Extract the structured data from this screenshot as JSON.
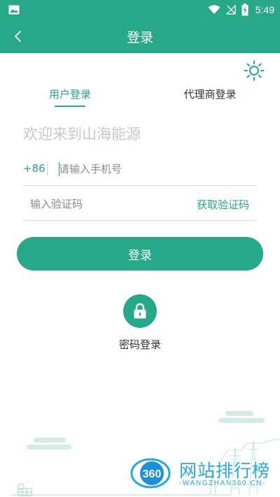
{
  "status_bar": {
    "time": "5:49",
    "icons": [
      "image-icon",
      "wifi-icon",
      "signal-off-icon",
      "battery-charging-icon"
    ]
  },
  "header": {
    "title": "登录",
    "back_icon": "back-arrow-icon"
  },
  "theme_icon": "sun-icon",
  "tabs": [
    {
      "label": "用户登录",
      "active": true
    },
    {
      "label": "代理商登录",
      "active": false
    }
  ],
  "welcome_text": "欢迎来到山海能源",
  "phone": {
    "country_code": "+86",
    "placeholder": "请输入手机号",
    "value": ""
  },
  "code": {
    "placeholder": "输入验证码",
    "value": "",
    "get_code_label": "获取验证码"
  },
  "login_button_label": "登录",
  "password_login": {
    "icon": "lock-icon",
    "label": "密码登录"
  },
  "watermark": {
    "logo_text": "360",
    "title": "网站排行榜",
    "subtitle": "-WANGZHAN360.CN-"
  },
  "colors": {
    "brand": "#26a889",
    "placeholder": "#8a8a8a",
    "welcome": "#c8c8c8",
    "watermark": "#26a8e0"
  }
}
